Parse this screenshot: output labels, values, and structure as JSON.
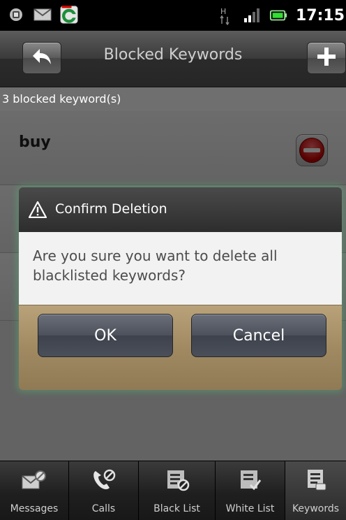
{
  "status_bar": {
    "time": "17:15",
    "icons": [
      "notification-icon",
      "mail-icon",
      "comodo-app-icon",
      "hspa-icon",
      "signal-icon",
      "battery-icon"
    ]
  },
  "title_bar": {
    "title": "Blocked Keywords",
    "back_icon": "back-arrow-icon",
    "add_icon": "plus-icon"
  },
  "count_label": "3 blocked keyword(s)",
  "keywords": [
    {
      "text": "buy"
    }
  ],
  "dialog": {
    "title": "Confirm Deletion",
    "message": "Are you sure you want to delete all blacklisted keywords?",
    "ok_label": "OK",
    "cancel_label": "Cancel"
  },
  "tabs": [
    {
      "label": "Messages",
      "icon": "messages-block-icon",
      "active": false
    },
    {
      "label": "Calls",
      "icon": "calls-block-icon",
      "active": false
    },
    {
      "label": "Black List",
      "icon": "black-list-icon",
      "active": false
    },
    {
      "label": "White List",
      "icon": "white-list-icon",
      "active": false
    },
    {
      "label": "Keywords",
      "icon": "keywords-icon",
      "active": true
    }
  ],
  "colors": {
    "accent_glow": "#50c878",
    "delete_red": "#d40000",
    "dialog_button_bar": "#a18a62"
  }
}
